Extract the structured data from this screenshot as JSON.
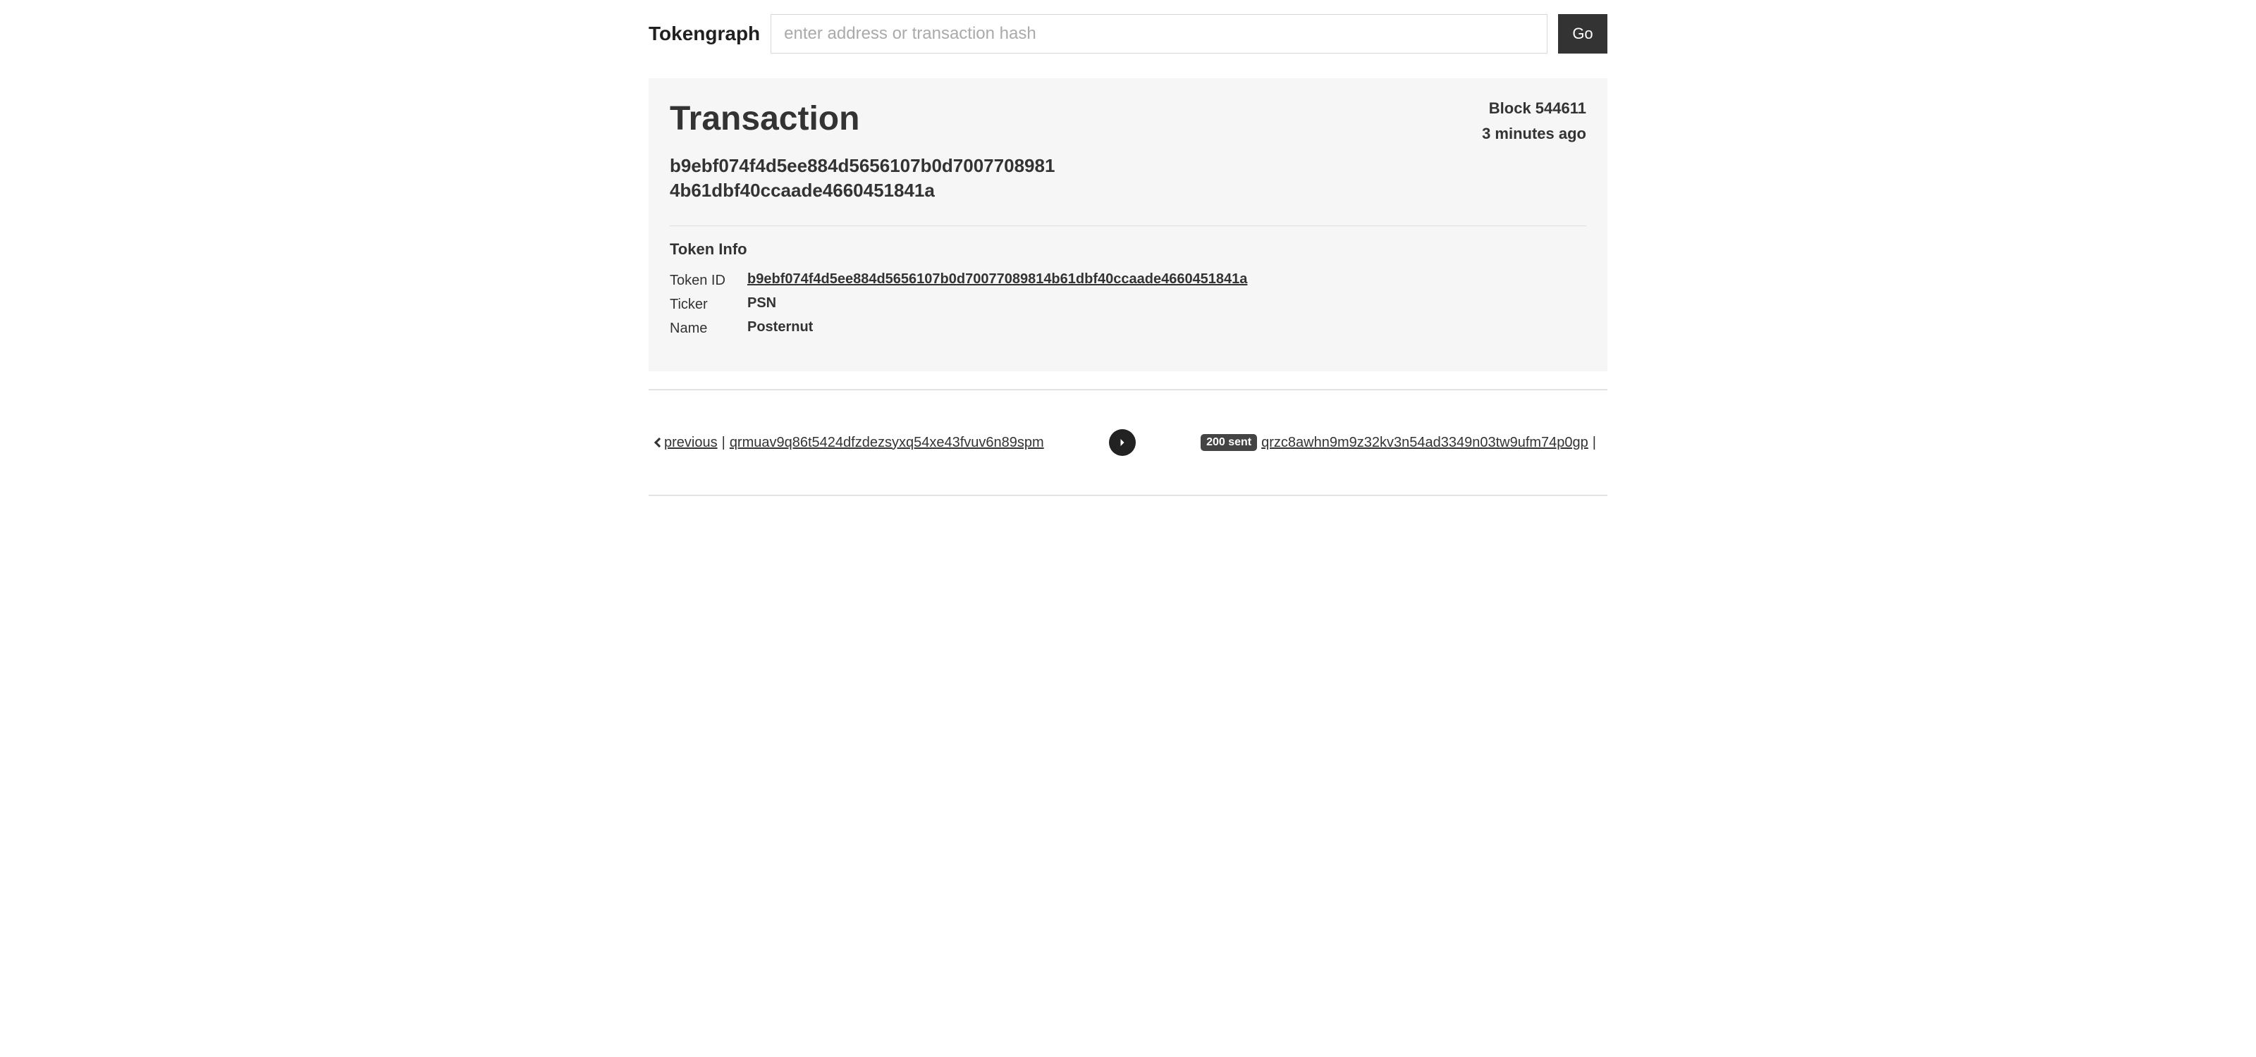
{
  "header": {
    "logo": "Tokengraph",
    "search_placeholder": "enter address or transaction hash",
    "go_label": "Go"
  },
  "transaction": {
    "title": "Transaction",
    "hash_line1": "b9ebf074f4d5ee884d5656107b0d7007708981",
    "hash_line2": "4b61dbf40ccaade4660451841a",
    "block_label": "Block 544611",
    "age": "3 minutes ago"
  },
  "token_info": {
    "title": "Token Info",
    "labels": {
      "token_id": "Token ID",
      "ticker": "Ticker",
      "name": "Name"
    },
    "values": {
      "token_id": "b9ebf074f4d5ee884d5656107b0d70077089814b61dbf40ccaade4660451841a",
      "ticker": "PSN",
      "name": "Posternut"
    }
  },
  "flow": {
    "previous_label": " previous",
    "left_address": "qrmuav9q86t5424dfzdezsyxq54xe43fvuv6n89spm",
    "badge": "200 sent",
    "right_address": "qrzc8awhn9m9z32kv3n54ad3349n03tw9ufm74p0gp",
    "separator": "|"
  }
}
